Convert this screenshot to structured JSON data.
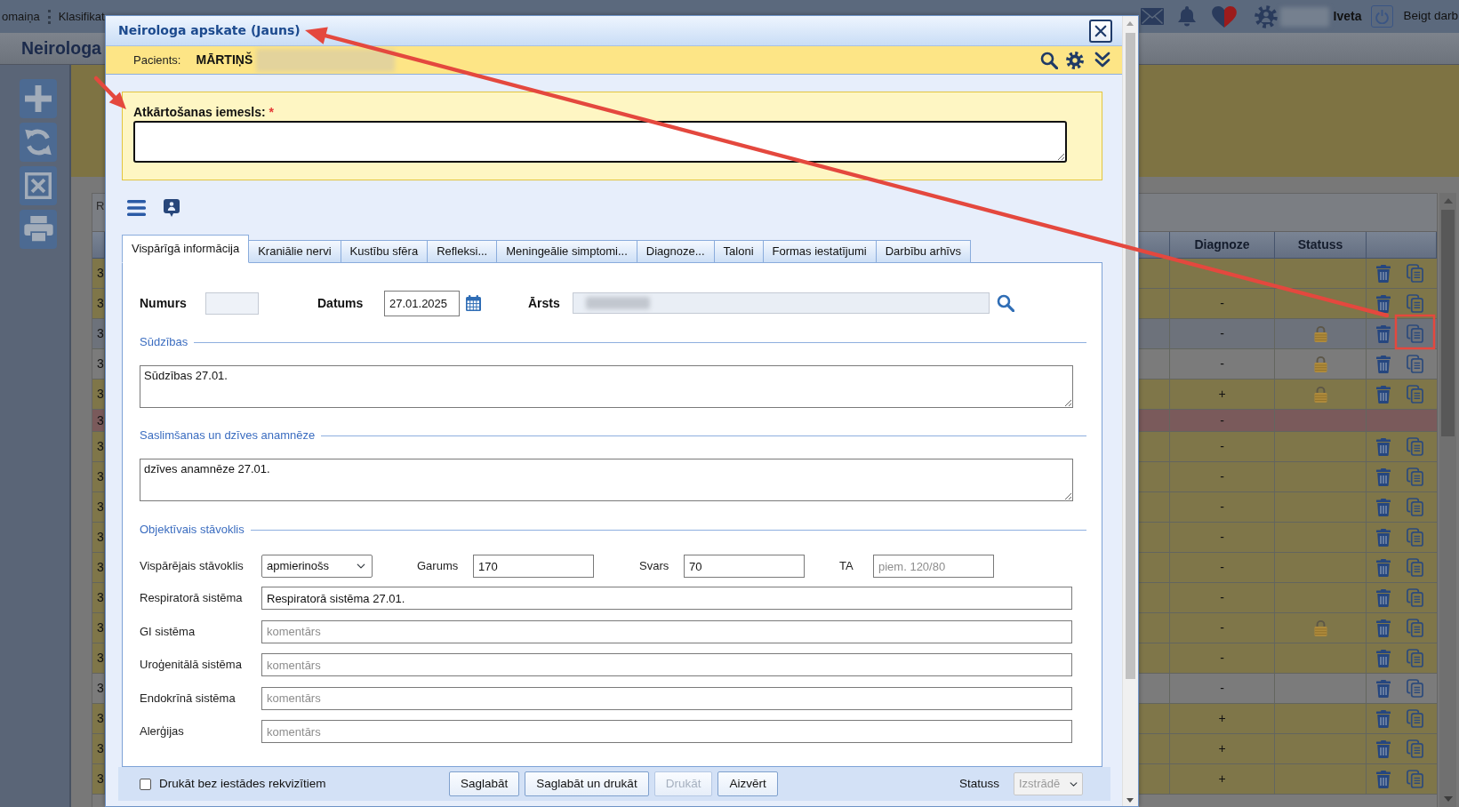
{
  "top_bar": {
    "menu": [
      "omaiņa",
      "Klasifikat"
    ],
    "user_name": "Iveta",
    "logout": "Beigt darb"
  },
  "page_title": "Neirologa",
  "table": {
    "toolbar_text": "R",
    "columns": [
      {
        "label": "Diagnoze"
      },
      {
        "label": "Statuss"
      }
    ],
    "rows": [
      {
        "column_1": "3",
        "actions": true,
        "locked": false,
        "color": "#7f7649"
      },
      {
        "column_1": "3",
        "diagnoze": "-",
        "actions": true,
        "locked": false,
        "color": "#7f7649"
      },
      {
        "column_1": "3",
        "diagnoze": "-",
        "actions": true,
        "locked": true,
        "color": "#6d727b"
      },
      {
        "column_1": "3",
        "diagnoze": "-",
        "actions": true,
        "locked": true,
        "color": "#7b7b7b"
      },
      {
        "column_1": "3",
        "diagnoze": "+",
        "actions": true,
        "locked": true,
        "color": "#7f7649"
      },
      {
        "column_1": "3",
        "diagnoze": "-",
        "actions": false,
        "locked": false,
        "color": "#7a5a5b"
      },
      {
        "column_1": "3",
        "diagnoze": "-",
        "actions": true,
        "locked": false,
        "color": "#7f7649"
      },
      {
        "column_1": "3",
        "diagnoze": "-",
        "actions": true,
        "locked": false,
        "color": "#7f7649"
      },
      {
        "column_1": "3",
        "diagnoze": "-",
        "actions": true,
        "locked": false,
        "color": "#7f7649"
      },
      {
        "column_1": "3",
        "diagnoze": "-",
        "actions": true,
        "locked": false,
        "color": "#7f7649"
      },
      {
        "column_1": "3",
        "diagnoze": "-",
        "actions": true,
        "locked": false,
        "color": "#7f7649"
      },
      {
        "column_1": "3",
        "diagnoze": "-",
        "actions": true,
        "locked": false,
        "color": "#7f7649"
      },
      {
        "column_1": "3",
        "diagnoze": "-",
        "actions": true,
        "locked": true,
        "color": "#7f7649"
      },
      {
        "column_1": "3",
        "diagnoze": "-",
        "actions": true,
        "locked": false,
        "color": "#7f7649"
      },
      {
        "column_1": "3",
        "diagnoze": "-",
        "actions": true,
        "locked": false,
        "color": "#7b7b7b"
      },
      {
        "column_1": "3",
        "diagnoze": "+",
        "actions": true,
        "locked": false,
        "color": "#7f7649"
      },
      {
        "column_1": "3",
        "diagnoze": "+",
        "actions": true,
        "locked": false,
        "color": "#7f7649"
      },
      {
        "column_1": "3",
        "diagnoze": "+",
        "actions": true,
        "locked": false,
        "color": "#7f7649"
      }
    ]
  },
  "dialog": {
    "title": "Neirologa apskate (Jauns)",
    "patient": {
      "label": "Pacients:",
      "name": "MĀRTIŅŠ"
    },
    "repeat_reason": {
      "label": "Atkārtošanas iemesls:",
      "required_mark": "*"
    },
    "tabs": [
      {
        "label": "Vispārīgā informācija",
        "selected": true
      },
      {
        "label": "Kraniālie nervi",
        "selected": false
      },
      {
        "label": "Kustību sfēra",
        "selected": false
      },
      {
        "label": "Refleksi...",
        "selected": false
      },
      {
        "label": "Meningeālie simptomi...",
        "selected": false
      },
      {
        "label": "Diagnoze...",
        "selected": false
      },
      {
        "label": "Taloni",
        "selected": false
      },
      {
        "label": "Formas iestatījumi",
        "selected": false
      },
      {
        "label": "Darbību arhīvs",
        "selected": false
      }
    ],
    "header_fields": [
      {
        "label": "Numurs",
        "kind": "number",
        "disabled": true
      },
      {
        "label": "Datums",
        "kind": "date",
        "value": "27.01.2025",
        "disabled": false
      },
      {
        "label": "Ārsts",
        "kind": "lookup",
        "disabled": true
      }
    ],
    "sections": [
      {
        "title": "Sūdzības",
        "value": "Sūdzības 27.01."
      },
      {
        "title": "Saslimšanas un dzīves anamnēze",
        "value": "dzīves anamnēze 27.01."
      },
      {
        "title": "Objektīvais stāvoklis",
        "vitals": [
          {
            "label": "Vispārējais stāvoklis",
            "kind": "select",
            "value": "apmierinošs"
          },
          {
            "label": "Garums",
            "kind": "input",
            "value": "170"
          },
          {
            "label": "Svars",
            "kind": "input",
            "value": "70"
          },
          {
            "label": "TA",
            "kind": "input",
            "placeholder": "piem. 120/80"
          }
        ],
        "systems": [
          {
            "label": "Respiratorā sistēma",
            "value": "Respiratorā sistēma 27.01."
          },
          {
            "label": "GI sistēma",
            "placeholder": "komentārs"
          },
          {
            "label": "Uroģenitālā sistēma",
            "placeholder": "komentārs"
          },
          {
            "label": "Endokrīnā sistēma",
            "placeholder": "komentārs"
          },
          {
            "label": "Alerģijas",
            "placeholder": "komentārs"
          }
        ]
      }
    ],
    "footer": {
      "print_option": {
        "label": "Drukāt bez iestādes rekvizītiem",
        "checked": false
      },
      "buttons": [
        {
          "label": "Saglabāt",
          "disabled": false
        },
        {
          "label": "Saglabāt un drukāt",
          "disabled": false
        },
        {
          "label": "Drukāt",
          "disabled": true
        },
        {
          "label": "Aizvērt",
          "disabled": false
        }
      ],
      "status": {
        "label": "Statuss",
        "value": "Izstrādē",
        "disabled": true
      }
    }
  }
}
